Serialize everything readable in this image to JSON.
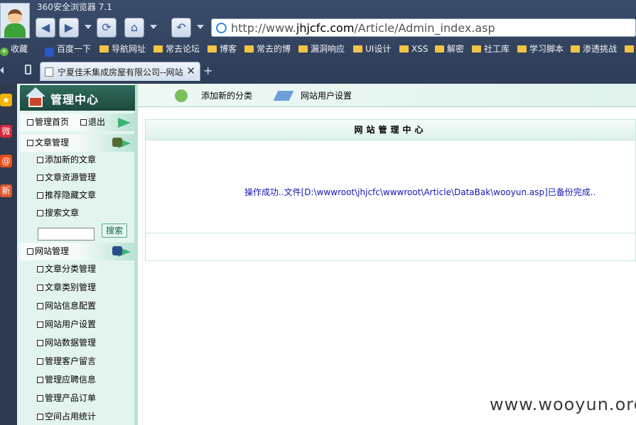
{
  "browser": {
    "title": "360安全浏览器 7.1",
    "url_prefix": "http://www.",
    "url_domain": "jhjcfc.com",
    "url_path": "/Article/Admin_index.asp",
    "tab_title": "宁夏佳禾集成房屋有限公司--网站",
    "tab_close": "✕",
    "new_tab": "+",
    "nav_back": "◀",
    "nav_forward": "▶",
    "nav_refresh": "⟳",
    "nav_home": "⌂",
    "nav_undo": "↶",
    "bookmarks": [
      "收藏",
      "百度一下",
      "导航网址",
      "常去论坛",
      "博客",
      "常去的博",
      "漏洞响应",
      "UI设计",
      "XSS",
      "解密",
      "社工库",
      "学习脚本",
      "渗透挑战"
    ],
    "bookmark_paw": "🐾",
    "bookmark_plus": "+"
  },
  "quickbar": [
    "★",
    "微",
    "@",
    "新"
  ],
  "nav": {
    "title": "管理中心",
    "home": "管理首页",
    "logout": "退出",
    "article_section": "文章管理",
    "article_items": [
      "添加新的文章",
      "文章资源管理",
      "推荐隐藏文章",
      "搜索文章"
    ],
    "search_button": "搜索",
    "site_section": "网站管理",
    "site_items": [
      "文章分类管理",
      "文章类别管理",
      "网站信息配置",
      "网站用户设置",
      "网站数据管理",
      "管理客户留言",
      "管理应聘信息",
      "管理产品订单",
      "空间占用统计"
    ]
  },
  "topbar": {
    "link1": "添加新的分类",
    "link2": "网站用户设置"
  },
  "panel": {
    "title": "网站管理中心",
    "message": "操作成功..文件[D:\\wwwroot\\jhjcfc\\wwwroot\\Article\\DataBak\\wooyun.asp]已备份完成.."
  },
  "watermark": "www.wooyun.org",
  "colors": {
    "chrome": "#2e3d57",
    "nav_header": "#1e4a3f",
    "nav_bg": "#e3f4ee",
    "message": "#1515b5"
  }
}
